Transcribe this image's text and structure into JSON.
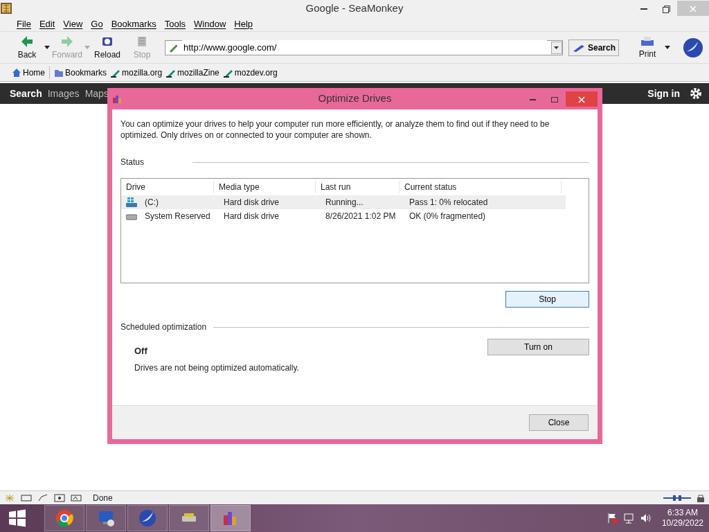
{
  "window": {
    "title": "Google - SeaMonkey"
  },
  "menu": [
    "File",
    "Edit",
    "View",
    "Go",
    "Bookmarks",
    "Tools",
    "Window",
    "Help"
  ],
  "toolbar": [
    {
      "label": "Back",
      "kind": "back",
      "disabled": false
    },
    {
      "label": "Forward",
      "kind": "forward",
      "disabled": true
    },
    {
      "label": "Reload",
      "kind": "reload",
      "disabled": false
    },
    {
      "label": "Stop",
      "kind": "stop",
      "disabled": true
    }
  ],
  "url": "http://www.google.com/",
  "search_button": "Search",
  "print_button": "Print",
  "bookmarks": [
    {
      "label": "Home",
      "kind": "home"
    },
    {
      "label": "Bookmarks",
      "kind": "folder"
    },
    {
      "label": "mozilla.org",
      "kind": "link"
    },
    {
      "label": "mozillaZine",
      "kind": "link"
    },
    {
      "label": "mozdev.org",
      "kind": "link"
    }
  ],
  "google_bar": {
    "links": [
      {
        "label": "Search",
        "selected": true
      },
      {
        "label": "Images",
        "selected": false
      },
      {
        "label": "Maps",
        "selected": false
      }
    ],
    "sign_in": "Sign in"
  },
  "dialog": {
    "title": "Optimize Drives",
    "intro": "You can optimize your drives to help your computer run more efficiently, or analyze them to find out if they need to be optimized. Only drives on or connected to your computer are shown.",
    "status_label": "Status",
    "columns": [
      "Drive",
      "Media type",
      "Last run",
      "Current status"
    ],
    "rows": [
      {
        "kind": "system",
        "cells": [
          "(C:)",
          "Hard disk drive",
          "Running...",
          "Pass 1: 0% relocated"
        ],
        "selected": true
      },
      {
        "kind": "disk",
        "cells": [
          "System Reserved",
          "Hard disk drive",
          "8/26/2021 1:02 PM",
          "OK (0% fragmented)"
        ],
        "selected": false
      }
    ],
    "stop_button": "Stop",
    "scheduled_label": "Scheduled optimization",
    "schedule_state": "Off",
    "schedule_desc": "Drives are not being optimized automatically.",
    "turn_on_button": "Turn on",
    "close_button": "Close"
  },
  "status_bar": "Done",
  "taskbar": [
    {
      "kind": "chrome",
      "active": false
    },
    {
      "kind": "remote",
      "active": false
    },
    {
      "kind": "seamonkey",
      "active": false
    },
    {
      "kind": "drive",
      "active": false
    },
    {
      "kind": "defrag",
      "active": true
    }
  ],
  "clock": {
    "time": "6:33 AM",
    "date": "10/29/2022"
  }
}
